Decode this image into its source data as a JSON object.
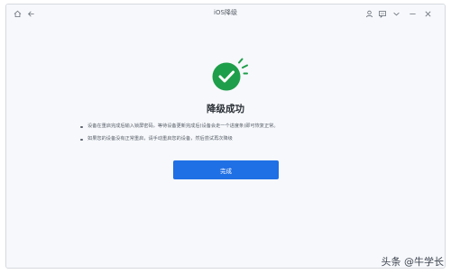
{
  "window": {
    "title": "iOS降级",
    "icons": [
      "home-icon",
      "back-arrow-icon",
      "user-icon",
      "feedback-icon",
      "chevron-down-icon",
      "minimize-icon",
      "close-icon"
    ]
  },
  "main": {
    "heading": "降级成功",
    "instructions": [
      "设备在重启完成后输入锁屏密码，等待设备更新完成后(设备会走一个进度条)即可恢复正常。",
      "如果您的设备没有正常重启，请手动重启您的设备，然后尝试再次降级"
    ],
    "done_button": "完成",
    "colors": {
      "success": "#1e9e4a",
      "button": "#1f6fe5"
    }
  },
  "watermark": "头条 @牛学长"
}
